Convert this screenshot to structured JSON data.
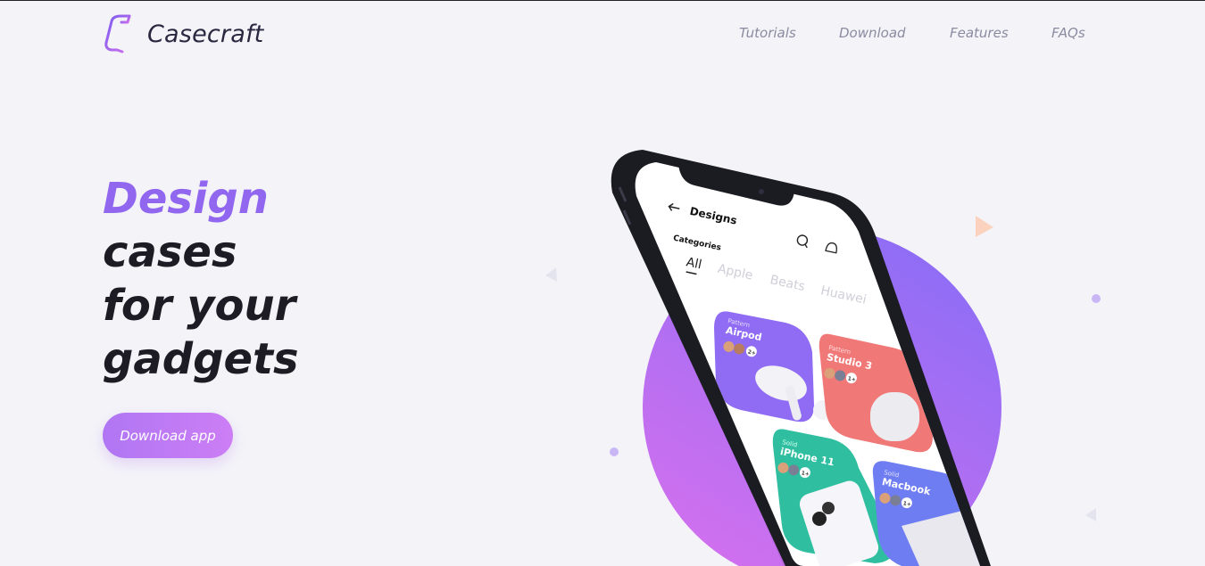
{
  "header": {
    "brand": "Casecraft",
    "nav": [
      "Tutorials",
      "Download",
      "Features",
      "FAQs"
    ]
  },
  "hero": {
    "accent_line": "Design",
    "lines": [
      "cases",
      "for your",
      "gadgets"
    ],
    "cta_label": "Download app"
  },
  "phone": {
    "screen_title": "Designs",
    "categories_label": "Categories",
    "tabs": [
      "All",
      "Apple",
      "Beats",
      "Huawei"
    ],
    "cards": [
      {
        "subtitle": "Pattern",
        "title": "Airpod",
        "count": "2+"
      },
      {
        "subtitle": "Pattern",
        "title": "Studio 3",
        "count": "1+"
      },
      {
        "subtitle": "Solid",
        "title": "iPhone 11",
        "count": "1+"
      },
      {
        "subtitle": "Solid",
        "title": "Macbook",
        "count": "1+"
      }
    ]
  },
  "colors": {
    "accent": "#9167f0",
    "cta": "#b076f3",
    "circle_top": "#8f6cf6",
    "circle_bottom": "#d171ef",
    "card_purple": "#8f6cf3",
    "card_coral": "#f07877",
    "card_teal": "#2fbfa0",
    "card_blue": "#6f7df3"
  },
  "icons": [
    "logo-icon",
    "back-arrow-icon",
    "search-icon",
    "bell-icon"
  ]
}
